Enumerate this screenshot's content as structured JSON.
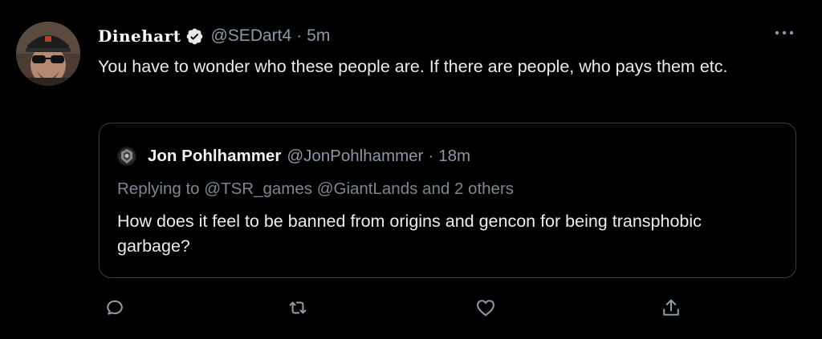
{
  "tweet": {
    "display_name": "Dinehart",
    "handle": "@SEDart4",
    "separator": "·",
    "time": "5m",
    "text": "You have to wonder who these people are. If there are people, who pays them etc.",
    "verified": true
  },
  "quoted_tweet": {
    "display_name": "Jon Pohlhammer",
    "handle": "@JonPohlhammer",
    "separator": "·",
    "time": "18m",
    "replying_to": "Replying to @TSR_games @GiantLands and 2 others",
    "text": "How does it feel to be banned from origins and gencon for being transphobic garbage?"
  },
  "actions": {
    "reply_icon": "comment-icon",
    "retweet_icon": "retweet-icon",
    "like_icon": "heart-icon",
    "share_icon": "share-icon"
  },
  "colors": {
    "background": "#000000",
    "secondary_text": "#8b98a5",
    "primary_text": "#ececec",
    "border": "#3a3d40"
  }
}
